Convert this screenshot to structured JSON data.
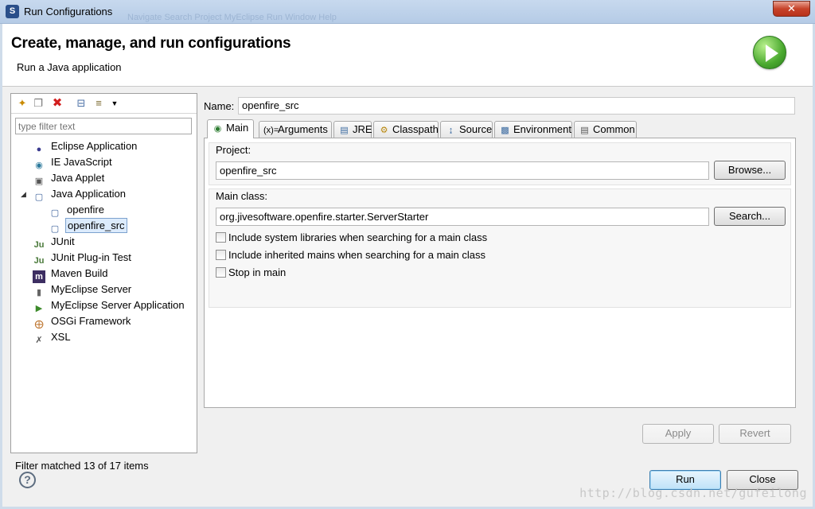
{
  "window": {
    "title": "Run Configurations",
    "close_label": "✕",
    "ghost_menu": "Navigate   Search   Project   MyEclipse   Run   Window   Help"
  },
  "header": {
    "title": "Create, manage, and run configurations",
    "subtitle": "Run a Java application"
  },
  "left_panel": {
    "filter_placeholder": "type filter text",
    "toolbar_icons": [
      "new-config-icon",
      "duplicate-icon",
      "delete-icon",
      "collapse-all-icon",
      "filter-icon",
      "dropdown-arrow-icon"
    ],
    "tree": [
      {
        "label": "Eclipse Application",
        "icon": "eclipse-icon"
      },
      {
        "label": "IE JavaScript",
        "icon": "globe-icon"
      },
      {
        "label": "Java Applet",
        "icon": "applet-icon"
      },
      {
        "label": "Java Application",
        "icon": "java-app-icon",
        "expanded": true,
        "children": [
          {
            "label": "openfire",
            "icon": "java-app-icon"
          },
          {
            "label": "openfire_src",
            "icon": "java-app-icon",
            "selected": true
          }
        ]
      },
      {
        "label": "JUnit",
        "icon": "junit-icon"
      },
      {
        "label": "JUnit Plug-in Test",
        "icon": "junit-plugin-icon"
      },
      {
        "label": "Maven Build",
        "icon": "maven-icon"
      },
      {
        "label": "MyEclipse Server",
        "icon": "server-icon"
      },
      {
        "label": "MyEclipse Server Application",
        "icon": "server-app-icon"
      },
      {
        "label": "OSGi Framework",
        "icon": "osgi-icon"
      },
      {
        "label": "XSL",
        "icon": "xsl-icon"
      }
    ],
    "status": "Filter matched 13 of 17 items"
  },
  "config": {
    "name_label": "Name:",
    "name_value": "openfire_src",
    "tabs": [
      {
        "label": "Main",
        "icon": "main-tab-icon",
        "active": true
      },
      {
        "label": "Arguments",
        "icon": "arguments-icon"
      },
      {
        "label": "JRE",
        "icon": "jre-icon"
      },
      {
        "label": "Classpath",
        "icon": "classpath-icon"
      },
      {
        "label": "Source",
        "icon": "source-icon"
      },
      {
        "label": "Environment",
        "icon": "environment-icon"
      },
      {
        "label": "Common",
        "icon": "common-icon"
      }
    ],
    "project_label": "Project:",
    "project_value": "openfire_src",
    "browse_label": "Browse...",
    "mainclass_label": "Main class:",
    "mainclass_value": "org.jivesoftware.openfire.starter.ServerStarter",
    "search_label": "Search...",
    "checkboxes": [
      {
        "label": "Include system libraries when searching for a main class",
        "checked": false
      },
      {
        "label": "Include inherited mains when searching for a main class",
        "checked": false
      },
      {
        "label": "Stop in main",
        "checked": false
      }
    ],
    "apply_label": "Apply",
    "revert_label": "Revert"
  },
  "footer": {
    "run_label": "Run",
    "close_label": "Close",
    "help_label": "?"
  },
  "watermark": "http://blog.csdn.net/gufeilong"
}
